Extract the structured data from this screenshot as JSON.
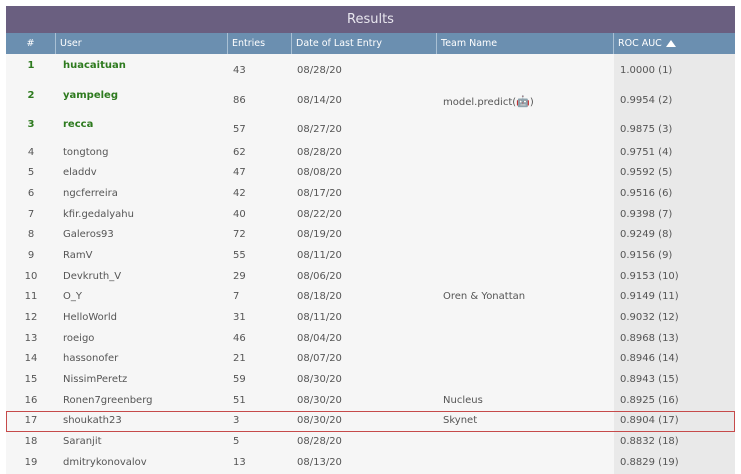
{
  "title": "Results",
  "columns": {
    "rank": "#",
    "user": "User",
    "entries": "Entries",
    "date": "Date of Last Entry",
    "team": "Team Name",
    "auc": "ROC AUC"
  },
  "sort_icon": "triangle-up-icon",
  "highlight_color": "#c64a4a",
  "top_color": "#2d7a1e",
  "rows": [
    {
      "rank": "1",
      "user": "huacaituan",
      "entries": "43",
      "date": "08/28/20",
      "team": "",
      "auc": "1.0000 (1)"
    },
    {
      "rank": "2",
      "user": "yampeleg",
      "entries": "86",
      "date": "08/14/20",
      "team": "model.predict(",
      "team_icon": "robot-icon",
      "team_suffix": ")",
      "auc": "0.9954 (2)"
    },
    {
      "rank": "3",
      "user": "recca",
      "entries": "57",
      "date": "08/27/20",
      "team": "",
      "auc": "0.9875 (3)"
    },
    {
      "rank": "4",
      "user": "tongtong",
      "entries": "62",
      "date": "08/28/20",
      "team": "",
      "auc": "0.9751 (4)"
    },
    {
      "rank": "5",
      "user": "eladdv",
      "entries": "47",
      "date": "08/08/20",
      "team": "",
      "auc": "0.9592 (5)"
    },
    {
      "rank": "6",
      "user": "ngcferreira",
      "entries": "42",
      "date": "08/17/20",
      "team": "",
      "auc": "0.9516 (6)"
    },
    {
      "rank": "7",
      "user": "kfir.gedalyahu",
      "entries": "40",
      "date": "08/22/20",
      "team": "",
      "auc": "0.9398 (7)"
    },
    {
      "rank": "8",
      "user": "Galeros93",
      "entries": "72",
      "date": "08/19/20",
      "team": "",
      "auc": "0.9249 (8)"
    },
    {
      "rank": "9",
      "user": "RamV",
      "entries": "55",
      "date": "08/11/20",
      "team": "",
      "auc": "0.9156 (9)"
    },
    {
      "rank": "10",
      "user": "Devkruth_V",
      "entries": "29",
      "date": "08/06/20",
      "team": "",
      "auc": "0.9153 (10)"
    },
    {
      "rank": "11",
      "user": "O_Y",
      "entries": "7",
      "date": "08/18/20",
      "team": "Oren & Yonattan",
      "auc": "0.9149 (11)"
    },
    {
      "rank": "12",
      "user": "HelloWorld",
      "entries": "31",
      "date": "08/11/20",
      "team": "",
      "auc": "0.9032 (12)"
    },
    {
      "rank": "13",
      "user": "roeigo",
      "entries": "46",
      "date": "08/04/20",
      "team": "",
      "auc": "0.8968 (13)"
    },
    {
      "rank": "14",
      "user": "hassonofer",
      "entries": "21",
      "date": "08/07/20",
      "team": "",
      "auc": "0.8946 (14)"
    },
    {
      "rank": "15",
      "user": "NissimPeretz",
      "entries": "59",
      "date": "08/30/20",
      "team": "",
      "auc": "0.8943 (15)"
    },
    {
      "rank": "16",
      "user": "Ronen7greenberg",
      "entries": "51",
      "date": "08/30/20",
      "team": "Nucleus",
      "auc": "0.8925 (16)"
    },
    {
      "rank": "17",
      "user": "shoukath23",
      "entries": "3",
      "date": "08/30/20",
      "team": "Skynet",
      "auc": "0.8904 (17)",
      "highlighted": true
    },
    {
      "rank": "18",
      "user": "Saranjit",
      "entries": "5",
      "date": "08/28/20",
      "team": "",
      "auc": "0.8832 (18)"
    },
    {
      "rank": "19",
      "user": "dmitrykonovalov",
      "entries": "13",
      "date": "08/13/20",
      "team": "",
      "auc": "0.8829 (19)"
    }
  ]
}
